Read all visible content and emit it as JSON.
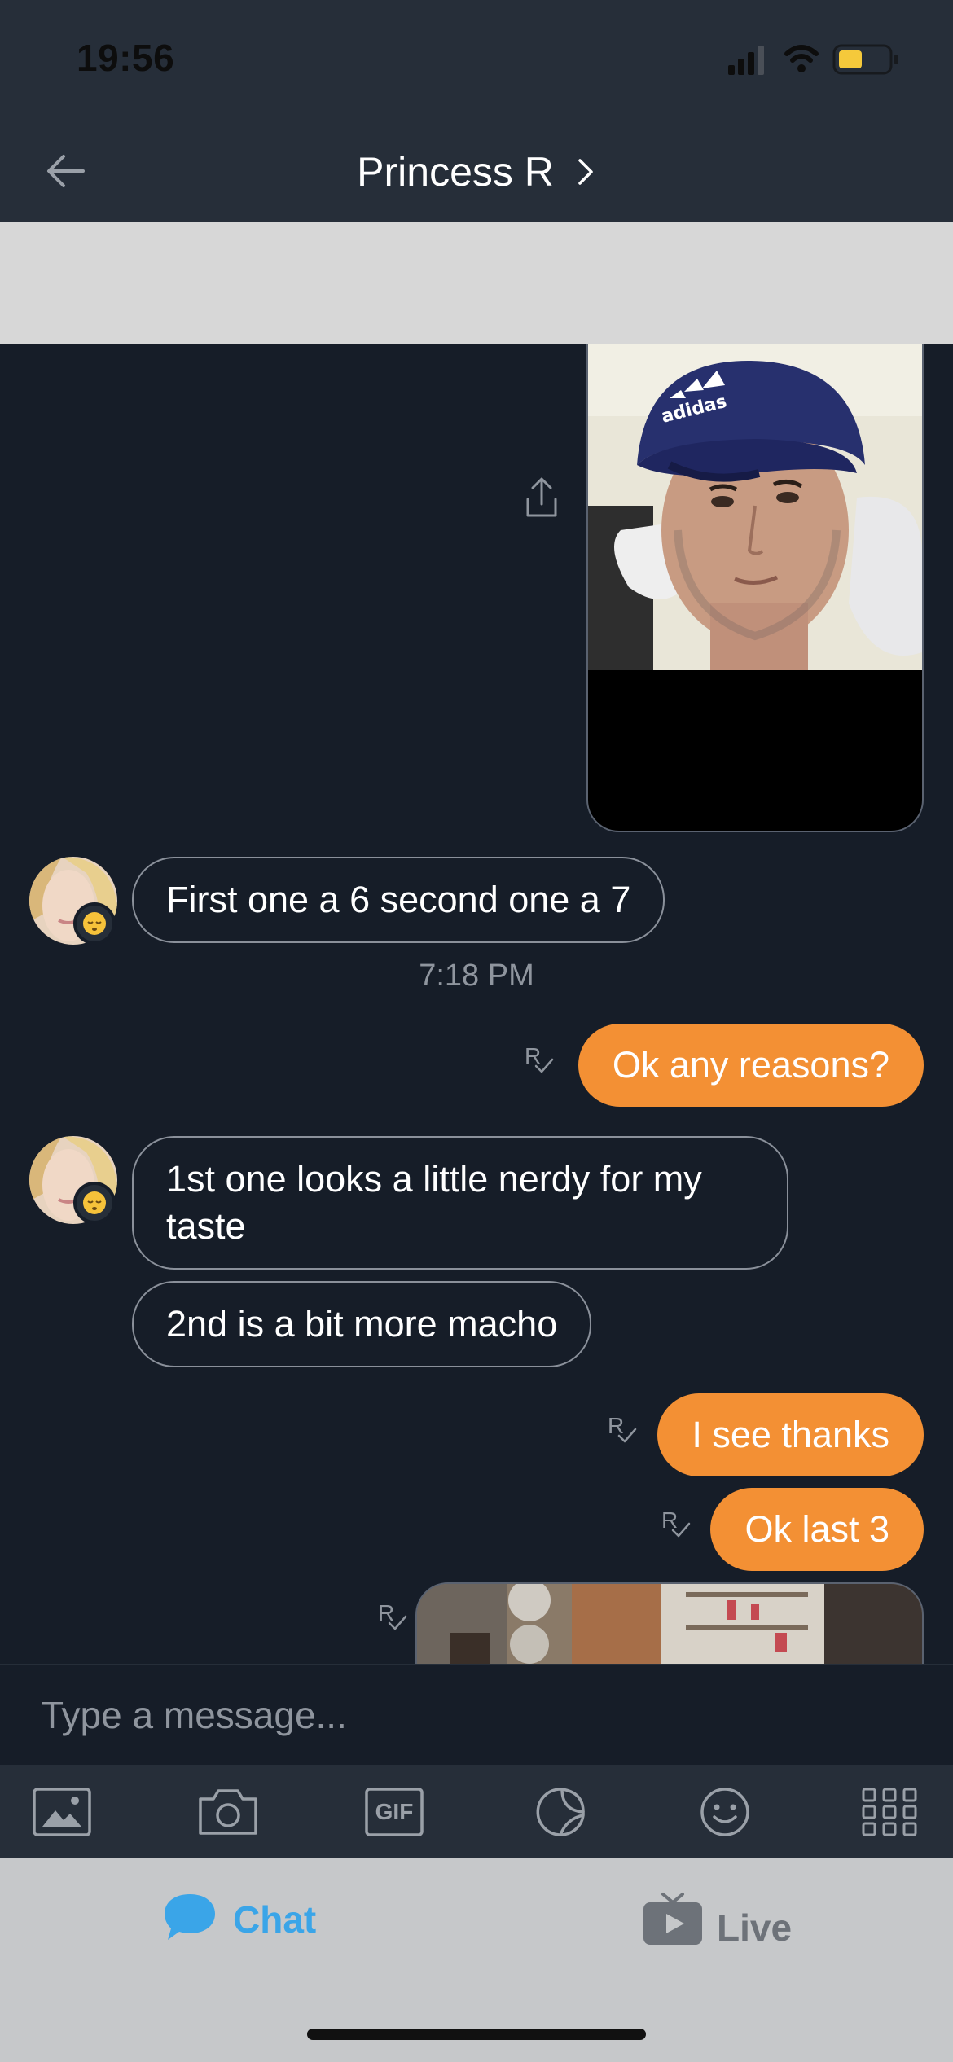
{
  "status_bar": {
    "time": "19:56"
  },
  "header": {
    "title": "Princess R"
  },
  "messages": {
    "in_1": "First one a 6 second one a 7",
    "timestamp_1": "7:18 PM",
    "out_1": "Ok any reasons?",
    "in_2": "1st one looks a little nerdy for my taste",
    "in_3": "2nd is a bit more macho",
    "out_2": "I see thanks",
    "out_3": "Ok last 3",
    "read_marker": "R"
  },
  "composer": {
    "placeholder": "Type a message..."
  },
  "toolbar": {
    "items": [
      "gallery-icon",
      "camera-icon",
      "gif-icon",
      "sticker-icon",
      "emoji-icon",
      "more-apps-icon"
    ],
    "gif_label": "GIF"
  },
  "tabs": {
    "chat_label": "Chat",
    "live_label": "Live"
  },
  "colors": {
    "accent_outgoing": "#f39034",
    "chat_tab_active": "#3aa5e8",
    "background": "#161d28",
    "header": "#262e39"
  }
}
